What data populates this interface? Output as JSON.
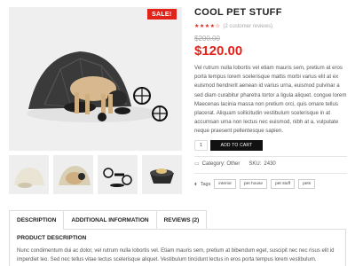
{
  "product": {
    "sale_badge": "SALE!",
    "title": "COOL PET STUFF",
    "rating_stars": "★★★★☆",
    "reviews_link": "(2 customer reviews)",
    "price_old": "$200.00",
    "price_new": "$120.00",
    "description": "Vel rutrum nulla lobortis vel etiam mauris sem, pretium at eros porta tempus lorem scelerisque mattis morbi varius elit at ex euismod hendrerit aenean id varius urna, euismod pulvinar a sed diam curabitur pharetra tortor a ligula aliquet. congue lorem Maecenas lacinia massa non pretium orci, quis ornare tellus placerat. Aliquam sollicitudin vestibulum scelerisque in at accumsan urna non lectus nec euismod, nibh at a, vulputate neque praesent pellentesque sapien."
  },
  "cart": {
    "quantity": "1",
    "button_label": "ADD TO CART"
  },
  "meta": {
    "category_label": "Category:",
    "category_value": "Other",
    "sku_label": "SKU:",
    "sku_value": "2430"
  },
  "tags": {
    "label": "Tags",
    "items": [
      "interior",
      "pet house",
      "pet stuff",
      "pets"
    ]
  },
  "tabs": {
    "items": [
      "DESCRIPTION",
      "ADDITIONAL INFORMATION",
      "REVIEWS (2)"
    ],
    "active": "DESCRIPTION"
  },
  "description_panel": {
    "heading": "PRODUCT DESCRIPTION",
    "text": "Nunc condimentum dui ac dolor, vel rutrum nulla lobortis vel. Etiam mauris sem, pretium at bibendum eget, suscipit nec nec risus elit id imperdiet leo. Sed nec tellus vitae lectus scelerisque aliquet. Vestibulum tincidunt lectus in eros porta tempus lorem vestibulum."
  },
  "icons": {
    "category": "folder-icon",
    "tags": "tag-icon"
  },
  "colors": {
    "accent": "#e2231a",
    "button": "#111111"
  }
}
